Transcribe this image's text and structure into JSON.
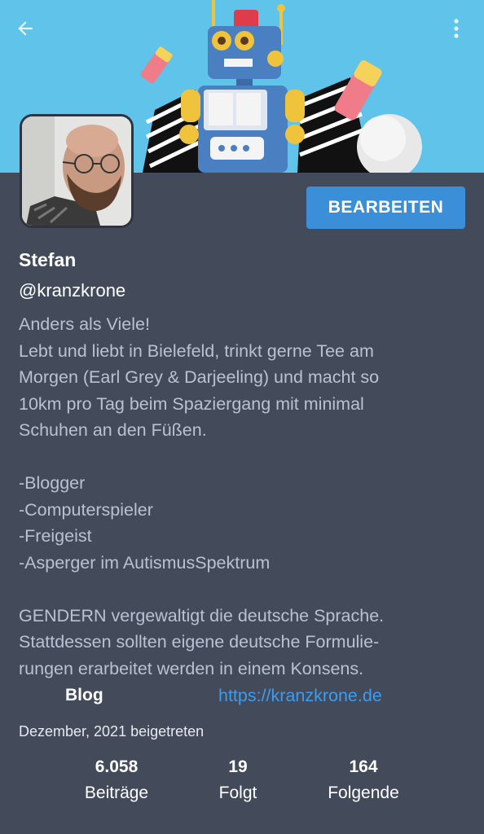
{
  "header": {
    "back_icon": "arrow-left-icon",
    "more_icon": "more-vertical-icon"
  },
  "profile": {
    "edit_label": "BEARBEITEN",
    "name": "Stefan",
    "handle": "@kranzkrone",
    "bio": [
      "Anders als Viele!",
      "Lebt und liebt in Bielefeld, trinkt gerne Tee am\nMorgen (Earl Grey & Darjeeling) und macht so\n10km pro Tag beim Spaziergang mit minimal\nSchuhen an den Füßen.",
      "",
      "-Blogger\n-Computerspieler\n-Freigeist\n-Asperger im AutismusSpektrum",
      "",
      "GENDERN vergewaltigt die deutsche Sprache.\nStattdessen sollten eigene deutsche Formulie-\nrungen erarbeitet werden in einem Konsens."
    ],
    "field": {
      "label": "Blog",
      "value": "https://kranzkrone.de"
    },
    "joined": "Dezember, 2021 beigetreten"
  },
  "stats": [
    {
      "value": "6.058",
      "label": "Beiträge"
    },
    {
      "value": "19",
      "label": "Folgt"
    },
    {
      "value": "164",
      "label": "Folgende"
    }
  ],
  "colors": {
    "background": "#434b5a",
    "banner": "#5fc3ea",
    "accent": "#3a8fd8",
    "link": "#3d9bf0",
    "bio_text": "#b8c2d2"
  }
}
